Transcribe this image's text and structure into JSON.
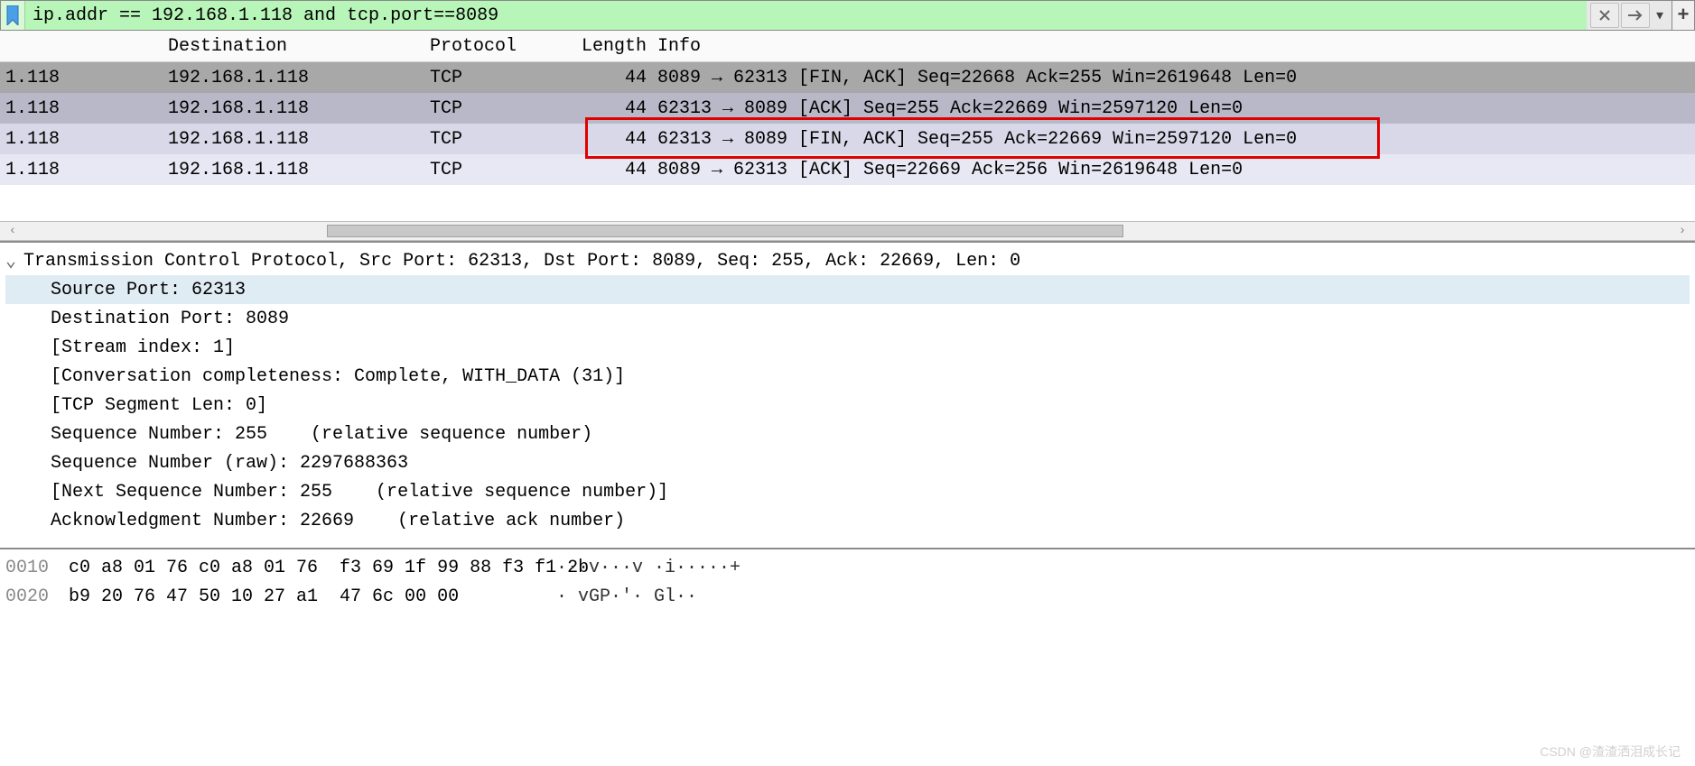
{
  "filter": {
    "text": "ip.addr == 192.168.1.118 and tcp.port==8089"
  },
  "columns": {
    "destination": "Destination",
    "protocol": "Protocol",
    "length": "Length",
    "info": "Info"
  },
  "packets": [
    {
      "src": "1.118",
      "dst": "192.168.1.118",
      "proto": "TCP",
      "len": "44",
      "info": "8089 → 62313 [FIN, ACK] Seq=22668 Ack=255 Win=2619648 Len=0"
    },
    {
      "src": "1.118",
      "dst": "192.168.1.118",
      "proto": "TCP",
      "len": "44",
      "info": "62313 → 8089 [ACK] Seq=255 Ack=22669 Win=2597120 Len=0"
    },
    {
      "src": "1.118",
      "dst": "192.168.1.118",
      "proto": "TCP",
      "len": "44",
      "info": "62313 → 8089 [FIN, ACK] Seq=255 Ack=22669 Win=2597120 Len=0"
    },
    {
      "src": "1.118",
      "dst": "192.168.1.118",
      "proto": "TCP",
      "len": "44",
      "info": "8089 → 62313 [ACK] Seq=22669 Ack=256 Win=2619648 Len=0"
    }
  ],
  "detail": {
    "header": "Transmission Control Protocol, Src Port: 62313, Dst Port: 8089, Seq: 255, Ack: 22669, Len: 0",
    "lines": [
      "Source Port: 62313",
      "Destination Port: 8089",
      "[Stream index: 1]",
      "[Conversation completeness: Complete, WITH_DATA (31)]",
      "[TCP Segment Len: 0]",
      "Sequence Number: 255    (relative sequence number)",
      "Sequence Number (raw): 2297688363",
      "[Next Sequence Number: 255    (relative sequence number)]",
      "Acknowledgment Number: 22669    (relative ack number)"
    ]
  },
  "hex": [
    {
      "off": "0010",
      "bytes": "c0 a8 01 76 c0 a8 01 76  f3 69 1f 99 88 f3 f1 2b",
      "ascii": "···v···v ·i·····+"
    },
    {
      "off": "0020",
      "bytes": "b9 20 76 47 50 10 27 a1  47 6c 00 00",
      "ascii": "· vGP·'· Gl··"
    }
  ],
  "watermark": "CSDN @渣渣洒泪成长记"
}
